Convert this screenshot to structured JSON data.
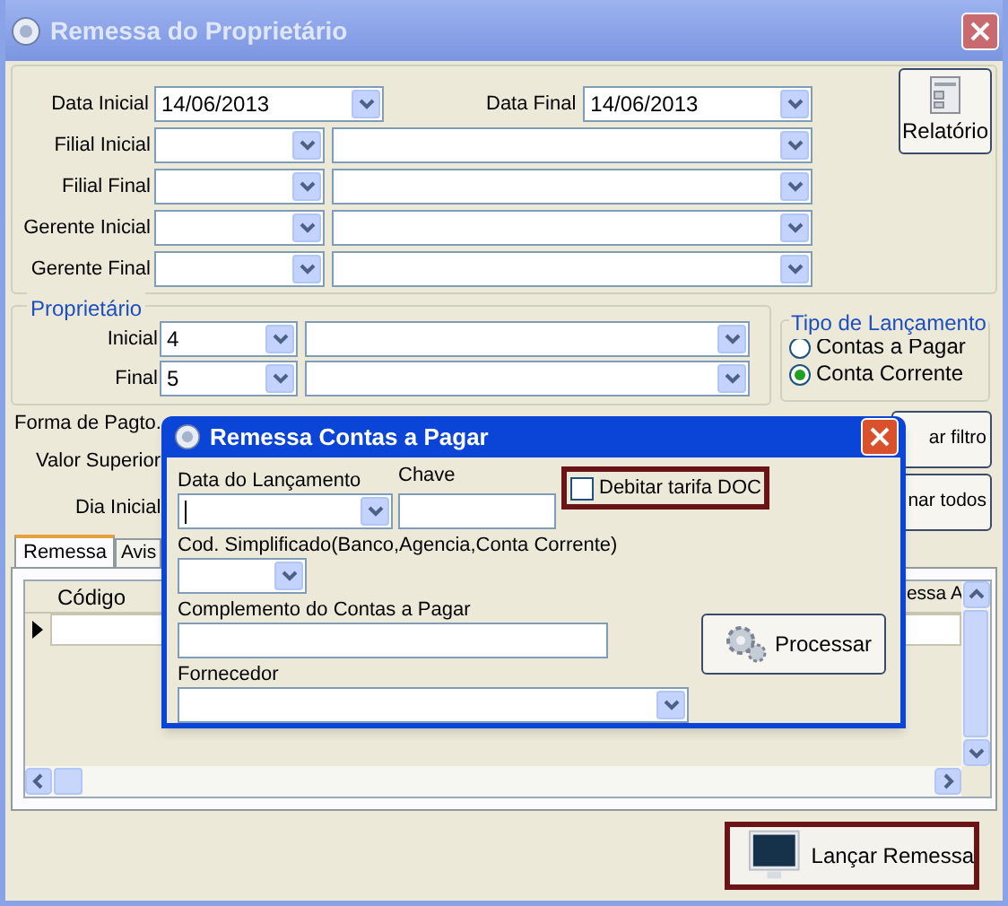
{
  "window": {
    "title": "Remessa do Proprietário"
  },
  "report_button": {
    "label": "Relatório"
  },
  "date_row": {
    "start_label": "Data Inicial",
    "start_value": "14/06/2013",
    "end_label": "Data Final",
    "end_value": "14/06/2013"
  },
  "filter_rows": [
    {
      "label": "Filial Inicial"
    },
    {
      "label": "Filial Final"
    },
    {
      "label": "Gerente Inicial"
    },
    {
      "label": "Gerente Final"
    }
  ],
  "owner_group": {
    "title": "Proprietário",
    "rows": [
      {
        "label": "Inicial",
        "value": "4"
      },
      {
        "label": "Final",
        "value": "5"
      }
    ]
  },
  "launch_type": {
    "title": "Tipo de Lançamento",
    "options": [
      {
        "label": "Contas a Pagar",
        "selected": false
      },
      {
        "label": "Conta Corrente",
        "selected": true
      }
    ]
  },
  "side_labels": [
    "Forma de Pagto.",
    "Valor Superior",
    "Dia Inicial"
  ],
  "side_buttons": [
    "ar filtro",
    "nar todos"
  ],
  "tabs": [
    {
      "label": "Remessa",
      "selected": true
    },
    {
      "label": "Avis",
      "selected": false
    }
  ],
  "grid": {
    "columns": [
      "Código",
      "essa A"
    ]
  },
  "launch_button": {
    "label": "Lançar Remessa"
  },
  "dialog": {
    "title": "Remessa Contas a Pagar",
    "date_label": "Data do Lançamento",
    "key_label": "Chave",
    "debit_checkbox": {
      "label": "Debitar tarifa DOC",
      "checked": false
    },
    "code_label": "Cod. Simplificado(Banco,Agencia,Conta Corrente)",
    "complement_label": "Complemento do Contas a Pagar",
    "supplier_label": "Fornecedor",
    "process_button": {
      "label": "Processar"
    }
  }
}
